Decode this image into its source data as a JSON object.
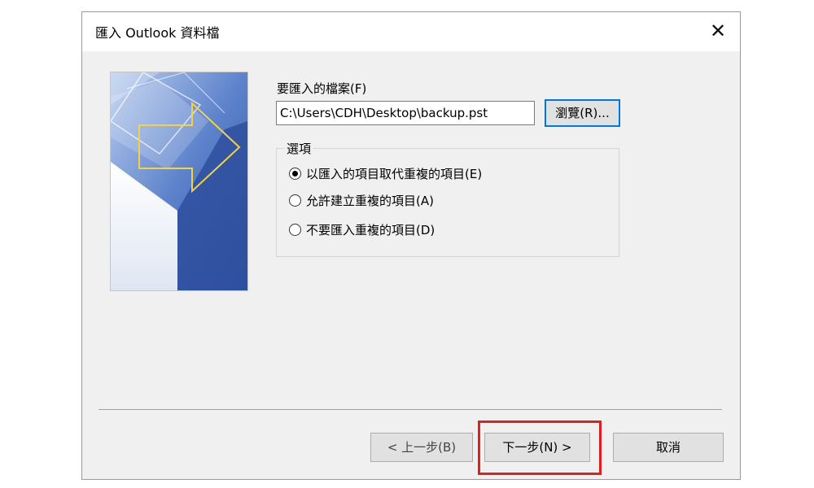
{
  "window": {
    "title": "匯入 Outlook 資料檔",
    "close_glyph": "✕"
  },
  "file": {
    "label": "要匯入的檔案(F)",
    "value": "C:\\Users\\CDH\\Desktop\\backup.pst",
    "browse_label": "瀏覽(R)..."
  },
  "options": {
    "label": "選項",
    "items": [
      {
        "label": "以匯入的項目取代重複的項目(E)",
        "selected": true
      },
      {
        "label": "允許建立重複的項目(A)",
        "selected": false
      },
      {
        "label": "不要匯入重複的項目(D)",
        "selected": false
      }
    ]
  },
  "footer": {
    "back_label": "< 上一步(B)",
    "next_label": "下一步(N) >",
    "cancel_label": "取消"
  },
  "colors": {
    "highlight": "#e02020",
    "focus": "#0078d7"
  }
}
